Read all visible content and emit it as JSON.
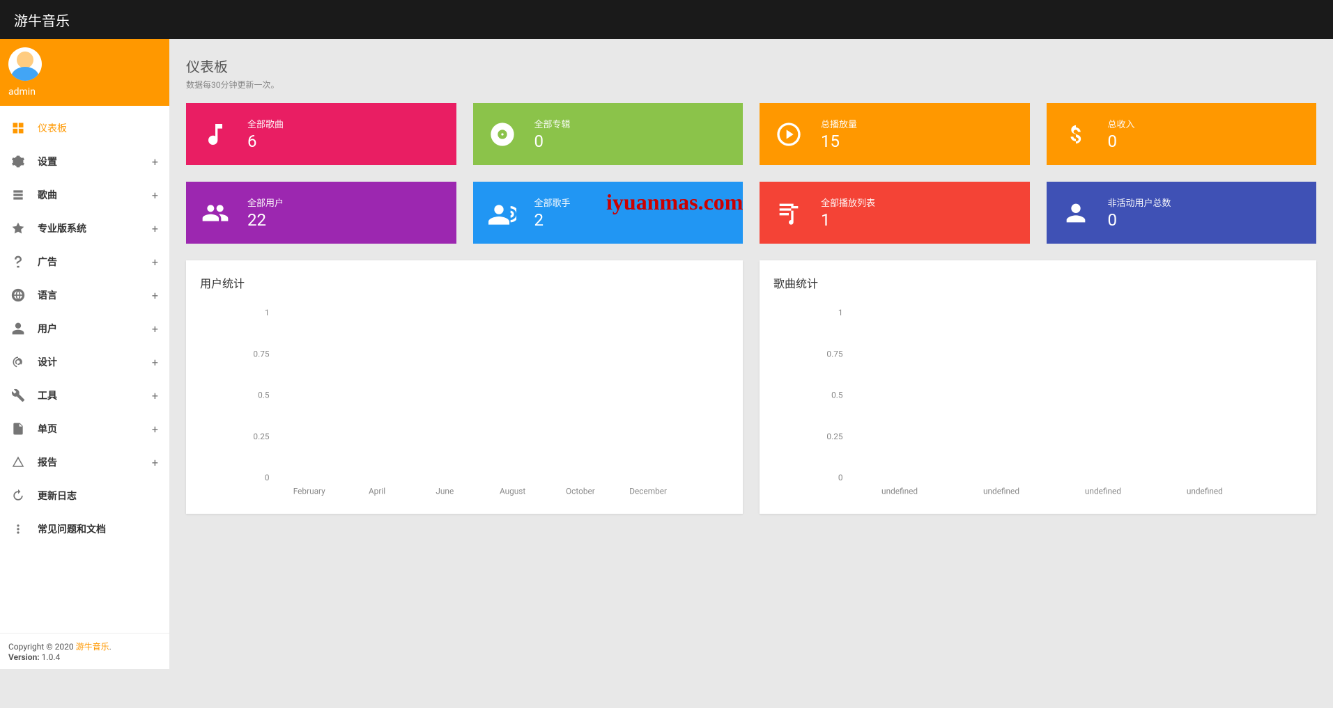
{
  "app_title": "游牛音乐",
  "user": {
    "name": "admin"
  },
  "sidebar": {
    "items": [
      {
        "label": "仪表板",
        "active": true,
        "expandable": false
      },
      {
        "label": "设置",
        "active": false,
        "expandable": true
      },
      {
        "label": "歌曲",
        "active": false,
        "expandable": true
      },
      {
        "label": "专业版系统",
        "active": false,
        "expandable": true
      },
      {
        "label": "广告",
        "active": false,
        "expandable": true
      },
      {
        "label": "语言",
        "active": false,
        "expandable": true
      },
      {
        "label": "用户",
        "active": false,
        "expandable": true
      },
      {
        "label": "设计",
        "active": false,
        "expandable": true
      },
      {
        "label": "工具",
        "active": false,
        "expandable": true
      },
      {
        "label": "单页",
        "active": false,
        "expandable": true
      },
      {
        "label": "报告",
        "active": false,
        "expandable": true
      },
      {
        "label": "更新日志",
        "active": false,
        "expandable": false
      },
      {
        "label": "常见问题和文档",
        "active": false,
        "expandable": false
      }
    ]
  },
  "footer": {
    "copyright_prefix": "Copyright © 2020 ",
    "copyright_link": "游牛音乐",
    "copyright_suffix": ".",
    "version_label": "Version:",
    "version_value": " 1.0.4"
  },
  "page": {
    "title": "仪表板",
    "subtitle": "数据每30分钟更新一次。"
  },
  "tiles": [
    {
      "label": "全部歌曲",
      "value": "6",
      "color": "bg-pink",
      "icon": "note"
    },
    {
      "label": "全部专辑",
      "value": "0",
      "color": "bg-green",
      "icon": "disc"
    },
    {
      "label": "总播放量",
      "value": "15",
      "color": "bg-orange",
      "icon": "play"
    },
    {
      "label": "总收入",
      "value": "0",
      "color": "bg-orange2",
      "icon": "dollar"
    },
    {
      "label": "全部用户",
      "value": "22",
      "color": "bg-purple",
      "icon": "users"
    },
    {
      "label": "全部歌手",
      "value": "2",
      "color": "bg-blue",
      "icon": "voice"
    },
    {
      "label": "全部播放列表",
      "value": "1",
      "color": "bg-red",
      "icon": "playlist"
    },
    {
      "label": "非活动用户总数",
      "value": "0",
      "color": "bg-indigo",
      "icon": "person"
    }
  ],
  "charts": [
    {
      "title": "用户统计"
    },
    {
      "title": "歌曲统计"
    }
  ],
  "chart_data": [
    {
      "type": "line",
      "title": "用户统计",
      "ylim": [
        0,
        1
      ],
      "yticks": [
        0,
        0.25,
        0.5,
        0.75,
        1
      ],
      "categories": [
        "February",
        "April",
        "June",
        "August",
        "October",
        "December"
      ],
      "values": []
    },
    {
      "type": "line",
      "title": "歌曲统计",
      "ylim": [
        0,
        1
      ],
      "yticks": [
        0,
        0.25,
        0.5,
        0.75,
        1
      ],
      "categories": [
        "undefined",
        "undefined",
        "undefined",
        "undefined"
      ],
      "values": []
    }
  ],
  "watermark": "iyuanmas.com"
}
